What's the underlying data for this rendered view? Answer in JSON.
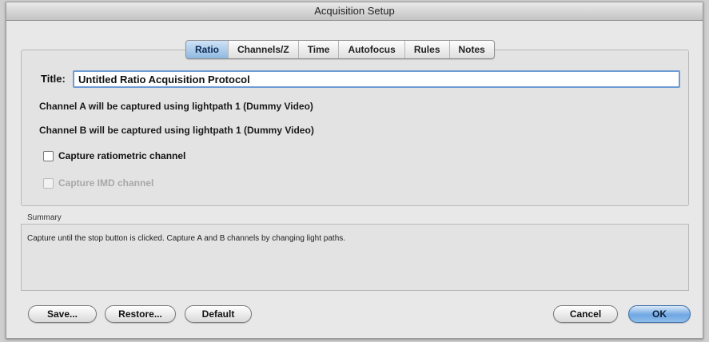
{
  "window": {
    "title": "Acquisition Setup"
  },
  "tabs": [
    {
      "label": "Ratio",
      "active": true
    },
    {
      "label": "Channels/Z"
    },
    {
      "label": "Time"
    },
    {
      "label": "Autofocus"
    },
    {
      "label": "Rules"
    },
    {
      "label": "Notes"
    }
  ],
  "form": {
    "title_label": "Title:",
    "title_value": "Untitled Ratio Acquisition Protocol",
    "channel_a": "Channel A will be captured using lightpath 1 (Dummy Video)",
    "channel_b": "Channel B will be captured using lightpath 1 (Dummy Video)",
    "capture_ratiometric": {
      "label": "Capture ratiometric channel",
      "checked": false
    },
    "capture_imd": {
      "label": "Capture IMD channel",
      "checked": false,
      "disabled": true
    }
  },
  "summary": {
    "label": "Summary",
    "text": "Capture until the stop button is clicked.  Capture A and B channels by changing light paths."
  },
  "buttons": {
    "save": "Save...",
    "restore": "Restore...",
    "default": "Default",
    "cancel": "Cancel",
    "ok": "OK"
  },
  "colors": {
    "accent": "#6fa7e3",
    "focus_ring": "#6e9bd3"
  }
}
